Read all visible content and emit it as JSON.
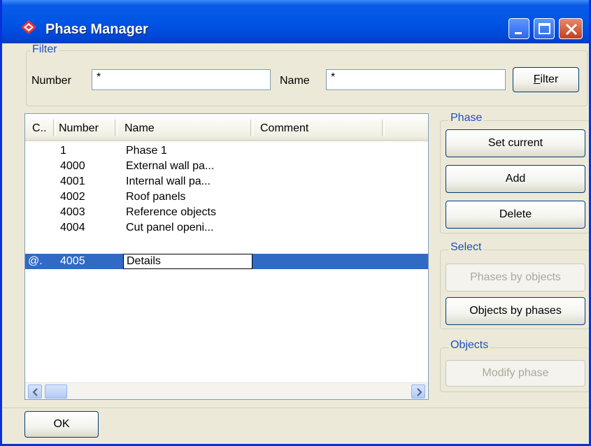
{
  "window": {
    "title": "Phase Manager",
    "accent": "#0055e5"
  },
  "filter": {
    "legend": "Filter",
    "number_label": "Number",
    "number_value": "*",
    "name_label": "Name",
    "name_value": "*",
    "button_label": "Filter",
    "button_mnemonic": "F"
  },
  "list": {
    "columns": [
      "C..",
      "Number",
      "Name",
      "Comment"
    ],
    "rows": [
      {
        "c": "",
        "number": "1",
        "name": "Phase 1",
        "comment": ""
      },
      {
        "c": "",
        "number": "4000",
        "name": "External wall pa...",
        "comment": ""
      },
      {
        "c": "",
        "number": "4001",
        "name": "Internal wall pa...",
        "comment": ""
      },
      {
        "c": "",
        "number": "4002",
        "name": "Roof panels",
        "comment": ""
      },
      {
        "c": "",
        "number": "4003",
        "name": "Reference objects",
        "comment": ""
      },
      {
        "c": "",
        "number": "4004",
        "name": "Cut panel openi...",
        "comment": ""
      },
      {
        "c": "@.",
        "number": "4005",
        "name": "Details",
        "comment": "",
        "selected": true,
        "editing": true
      }
    ]
  },
  "phase_group": {
    "legend": "Phase",
    "set_current": "Set current",
    "add": "Add",
    "delete": "Delete"
  },
  "select_group": {
    "legend": "Select",
    "phases_by_objects": "Phases by objects",
    "objects_by_phases": "Objects by phases"
  },
  "objects_group": {
    "legend": "Objects",
    "modify_phase": "Modify phase"
  },
  "footer": {
    "ok": "OK"
  },
  "icons": {
    "app": "phase-manager-icon",
    "minimize": "minimize-icon",
    "maximize": "maximize-icon",
    "close": "close-icon",
    "scroll_left": "arrow-left-icon",
    "scroll_right": "arrow-right-icon"
  },
  "colors": {
    "selection": "#316ac5",
    "group_legend": "#1f4fbf",
    "disabled_text": "#aca899"
  }
}
